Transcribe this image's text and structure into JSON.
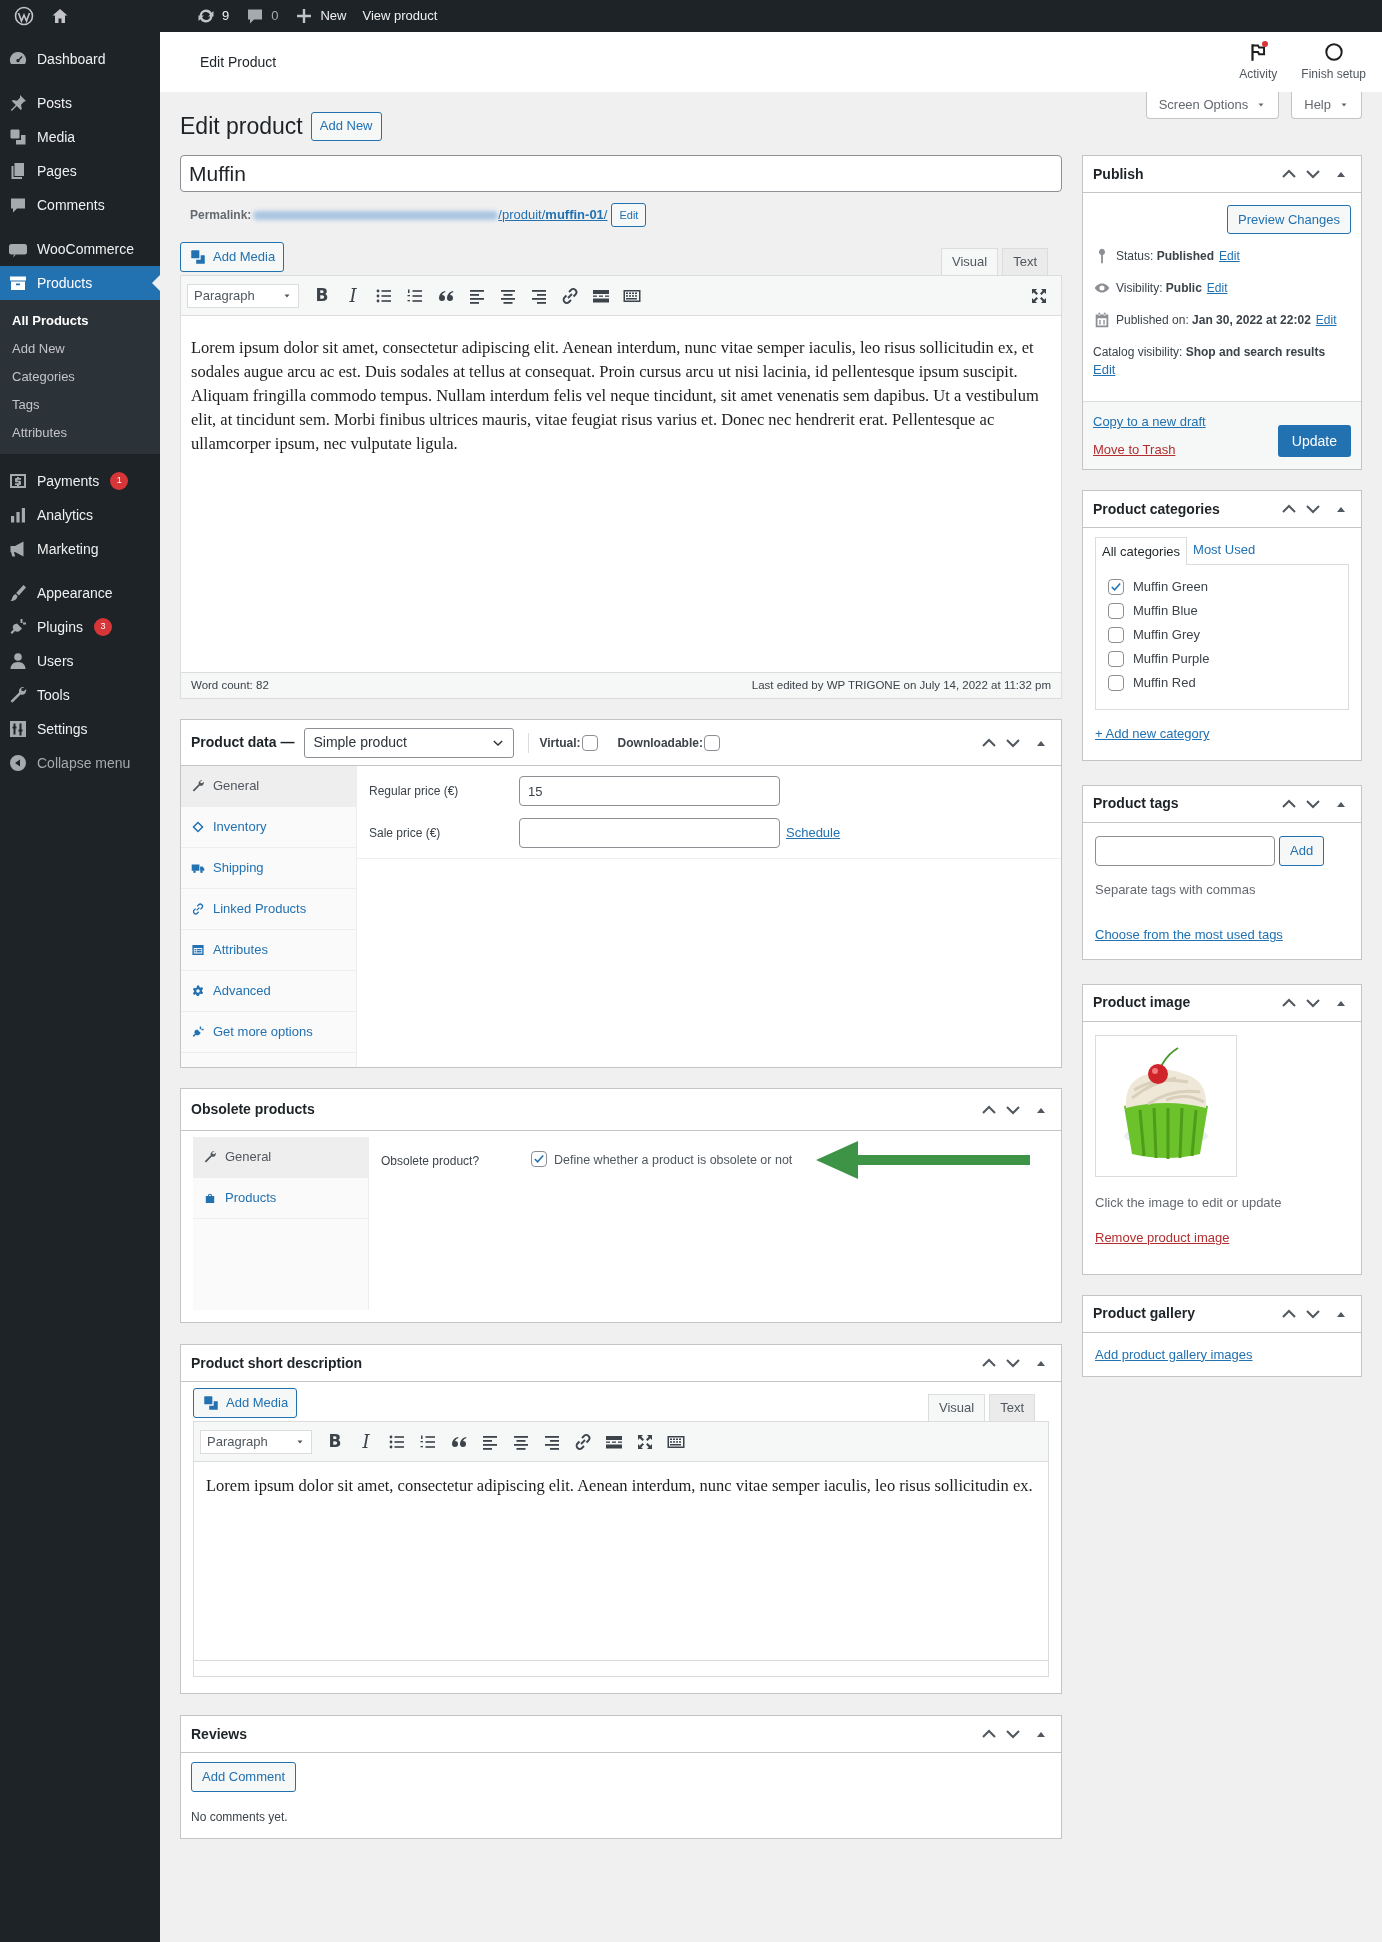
{
  "admin_bar": {
    "items": [
      {
        "kind": "logo"
      },
      {
        "kind": "home"
      },
      {
        "kind": "updates",
        "label": "9"
      },
      {
        "kind": "comments",
        "label": "0"
      },
      {
        "kind": "new",
        "label": "New"
      },
      {
        "kind": "link",
        "label": "View product"
      }
    ]
  },
  "sidebar": {
    "groups": [
      {
        "items": [
          {
            "kind": "dashboard",
            "label": "Dashboard",
            "selected": false
          }
        ]
      },
      {
        "items": [
          {
            "kind": "posts",
            "label": "Posts",
            "selected": false
          },
          {
            "kind": "media",
            "label": "Media",
            "selected": false
          },
          {
            "kind": "pages",
            "label": "Pages",
            "selected": false
          },
          {
            "kind": "comments",
            "label": "Comments",
            "selected": false
          }
        ]
      },
      {
        "items": [
          {
            "kind": "woo",
            "label": "WooCommerce",
            "selected": false
          },
          {
            "kind": "products",
            "label": "Products",
            "selected": true,
            "children": [
              {
                "label": "All Products",
                "selected": true
              },
              {
                "label": "Add New",
                "selected": false
              },
              {
                "label": "Categories",
                "selected": false
              },
              {
                "label": "Tags",
                "selected": false
              },
              {
                "label": "Attributes",
                "selected": false
              }
            ]
          }
        ]
      },
      {
        "items": [
          {
            "kind": "payments",
            "label": "Payments",
            "badge": "1",
            "selected": false
          },
          {
            "kind": "analytics",
            "label": "Analytics",
            "selected": false
          },
          {
            "kind": "marketing",
            "label": "Marketing",
            "selected": false
          }
        ]
      },
      {
        "items": [
          {
            "kind": "appearance",
            "label": "Appearance",
            "selected": false
          },
          {
            "kind": "plugins",
            "label": "Plugins",
            "badge": "3",
            "selected": false
          },
          {
            "kind": "users",
            "label": "Users",
            "selected": false
          },
          {
            "kind": "tools",
            "label": "Tools",
            "selected": false
          },
          {
            "kind": "settings",
            "label": "Settings",
            "selected": false
          },
          {
            "kind": "collapse",
            "label": "Collapse menu",
            "selected": false
          }
        ]
      }
    ]
  },
  "header": {
    "title": "Edit Product",
    "actions": [
      {
        "kind": "activity",
        "label": "Activity",
        "has_notification": true
      },
      {
        "kind": "setup",
        "label": "Finish setup",
        "has_notification": false
      }
    ]
  },
  "screen_tabs": [
    "Screen Options",
    "Help"
  ],
  "page": {
    "heading": "Edit product",
    "add_new": "Add New"
  },
  "title_field": {
    "value": "Muffin"
  },
  "permalink": {
    "label": "Permalink:",
    "link": "/produit/**muffin-01**/",
    "button": "Edit"
  },
  "editor": {
    "add_media": "Add Media",
    "tabs": [
      {
        "label": "Visual",
        "selected": true
      },
      {
        "label": "Text",
        "selected": false
      }
    ],
    "format": "Paragraph",
    "toolbar": [
      {
        "kind": "bold",
        "label": "B"
      },
      {
        "kind": "italic",
        "label": "I"
      },
      {
        "kind": "bullets"
      },
      {
        "kind": "numbers"
      },
      {
        "kind": "quote"
      },
      {
        "kind": "left"
      },
      {
        "kind": "center"
      },
      {
        "kind": "right"
      },
      {
        "kind": "link"
      },
      {
        "kind": "more"
      },
      {
        "kind": "keyboard"
      },
      {
        "kind": "fullscreen"
      }
    ],
    "content": "Lorem ipsum dolor sit amet, consectetur adipiscing elit. Aenean interdum, nunc vitae semper iaculis, leo risus sollicitudin ex, et sodales augue arcu ac est. Duis sodales at tellus at consequat. Proin cursus arcu ut nisi lacinia, id pellentesque ipsum suscipit. Aliquam fringilla commodo tempus. Nullam interdum felis vel neque tincidunt, sit amet venenatis sem dapibus. Ut a vestibulum elit, at tincidunt sem. Morbi finibus ultrices mauris, vitae feugiat risus varius et. Donec nec hendrerit erat. Pellentesque ac ullamcorper ipsum, nec vulputate ligula.",
    "word_count": "Word count: 82",
    "last_edited": "Last edited by WP TRIGONE on July 14, 2022 at 11:32 pm"
  },
  "product_data": {
    "title": "Product data —",
    "type": "Simple product",
    "options": [
      {
        "label": "Virtual:",
        "checked": false
      },
      {
        "label": "Downloadable:",
        "checked": false
      }
    ],
    "tabs": [
      {
        "kind": "general",
        "label": "General",
        "selected": true
      },
      {
        "kind": "inventory",
        "label": "Inventory",
        "selected": false
      },
      {
        "kind": "shipping",
        "label": "Shipping",
        "selected": false
      },
      {
        "kind": "linked",
        "label": "Linked Products",
        "selected": false
      },
      {
        "kind": "attributes",
        "label": "Attributes",
        "selected": false
      },
      {
        "kind": "advanced",
        "label": "Advanced",
        "selected": false
      },
      {
        "kind": "more",
        "label": "Get more options",
        "selected": false
      }
    ],
    "fields": [
      {
        "label": "Regular price (€)",
        "value": "15"
      },
      {
        "label": "Sale price (€)",
        "link": "Schedule"
      }
    ]
  },
  "obsolete": {
    "title": "Obsolete products",
    "tabs": [
      {
        "kind": "general",
        "label": "General",
        "selected": true
      },
      {
        "kind": "products",
        "label": "Products",
        "selected": false
      }
    ],
    "field": {
      "label": "Obsolete product?",
      "checked": true,
      "description": "Define whether a product is obsolete or not"
    }
  },
  "short_description": {
    "title": "Product short description",
    "add_media": "Add Media",
    "tabs": [
      {
        "label": "Visual",
        "selected": true
      },
      {
        "label": "Text",
        "selected": false
      }
    ],
    "format": "Paragraph",
    "toolbar": [
      {
        "kind": "bold",
        "label": "B"
      },
      {
        "kind": "italic",
        "label": "I"
      },
      {
        "kind": "bullets"
      },
      {
        "kind": "numbers"
      },
      {
        "kind": "quote"
      },
      {
        "kind": "left"
      },
      {
        "kind": "center"
      },
      {
        "kind": "right"
      },
      {
        "kind": "link"
      },
      {
        "kind": "more"
      },
      {
        "kind": "fullscreen"
      },
      {
        "kind": "keyboard"
      }
    ],
    "content": "Lorem ipsum dolor sit amet, consectetur adipiscing elit. Aenean interdum, nunc vitae semper iaculis, leo risus sollicitudin ex."
  },
  "reviews": {
    "title": "Reviews",
    "button": "Add Comment",
    "empty": "No comments yet."
  },
  "publish": {
    "title": "Publish",
    "preview": "Preview Changes",
    "rows": [
      {
        "kind": "status",
        "text": "Status: **Published**",
        "link": "Edit"
      },
      {
        "kind": "visibility",
        "text": "Visibility: **Public**",
        "link": "Edit"
      },
      {
        "kind": "date",
        "text": "Published on: **Jan 30, 2022 at 22:02**",
        "link": "Edit"
      },
      {
        "kind": "catalog",
        "text": "Catalog visibility: **Shop and search results**",
        "link": "Edit"
      }
    ],
    "copy": "Copy to a new draft",
    "trash": "Move to Trash",
    "update": "Update"
  },
  "categories": {
    "title": "Product categories",
    "tabs": [
      {
        "label": "All categories",
        "selected": true
      },
      {
        "label": "Most Used",
        "selected": false
      }
    ],
    "items": [
      {
        "label": "Muffin Green",
        "checked": true
      },
      {
        "label": "Muffin Blue",
        "checked": false
      },
      {
        "label": "Muffin Grey",
        "checked": false
      },
      {
        "label": "Muffin Purple",
        "checked": false
      },
      {
        "label": "Muffin Red",
        "checked": false
      }
    ],
    "add_link": "+ Add new category"
  },
  "tags": {
    "title": "Product tags",
    "button": "Add",
    "hint": "Separate tags with commas",
    "link": "Choose from the most used tags"
  },
  "product_image": {
    "title": "Product image",
    "caption": "Click the image to edit or update",
    "remove": "Remove product image"
  },
  "gallery": {
    "title": "Product gallery",
    "link": "Add product gallery images"
  }
}
